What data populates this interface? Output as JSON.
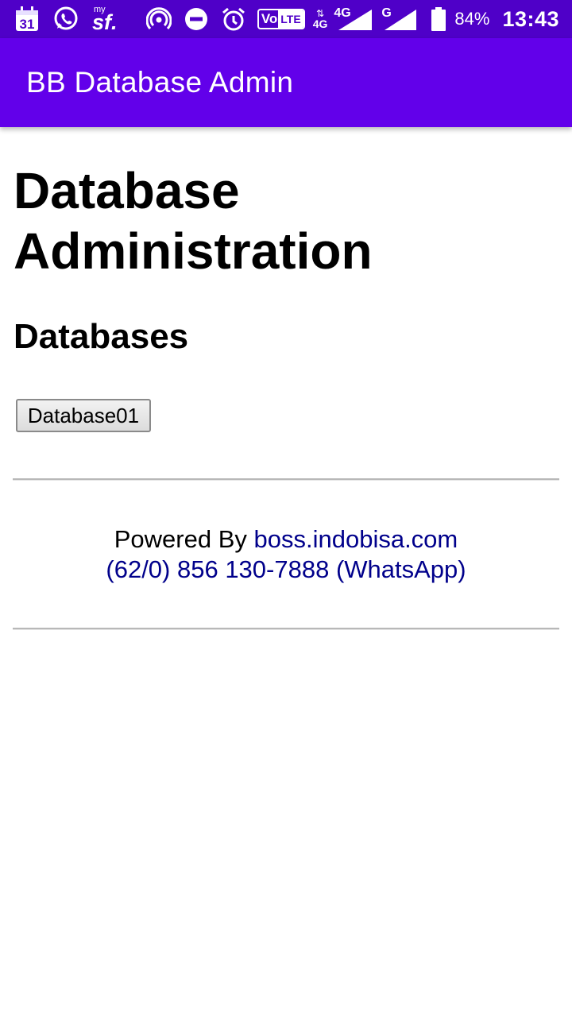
{
  "status_bar": {
    "calendar_day": "31",
    "carrier_logo_top": "my",
    "carrier_logo": "sf.",
    "volte_label_a": "Vo",
    "volte_label_b": "LTE",
    "net_4g_a": "4G",
    "net_4g_b": "4G",
    "net_g": "G",
    "battery": "84%",
    "time": "13:43",
    "icons": [
      "calendar-icon",
      "whatsapp-icon",
      "carrier-logo",
      "hotspot-icon",
      "do-not-disturb-icon",
      "alarm-icon",
      "volte-icon",
      "data-arrows-icon",
      "signal-icon",
      "battery-icon"
    ]
  },
  "app_bar": {
    "title": "BB Database Admin",
    "color": "#6200ea"
  },
  "main": {
    "title": "Database Administration",
    "section_title": "Databases",
    "database_button": "Database01"
  },
  "footer": {
    "powered_by": "Powered By",
    "site_link": "boss.indobisa.com",
    "phone_link": "(62/0) 856 130-7888 (WhatsApp)",
    "link_color": "#00008b"
  }
}
